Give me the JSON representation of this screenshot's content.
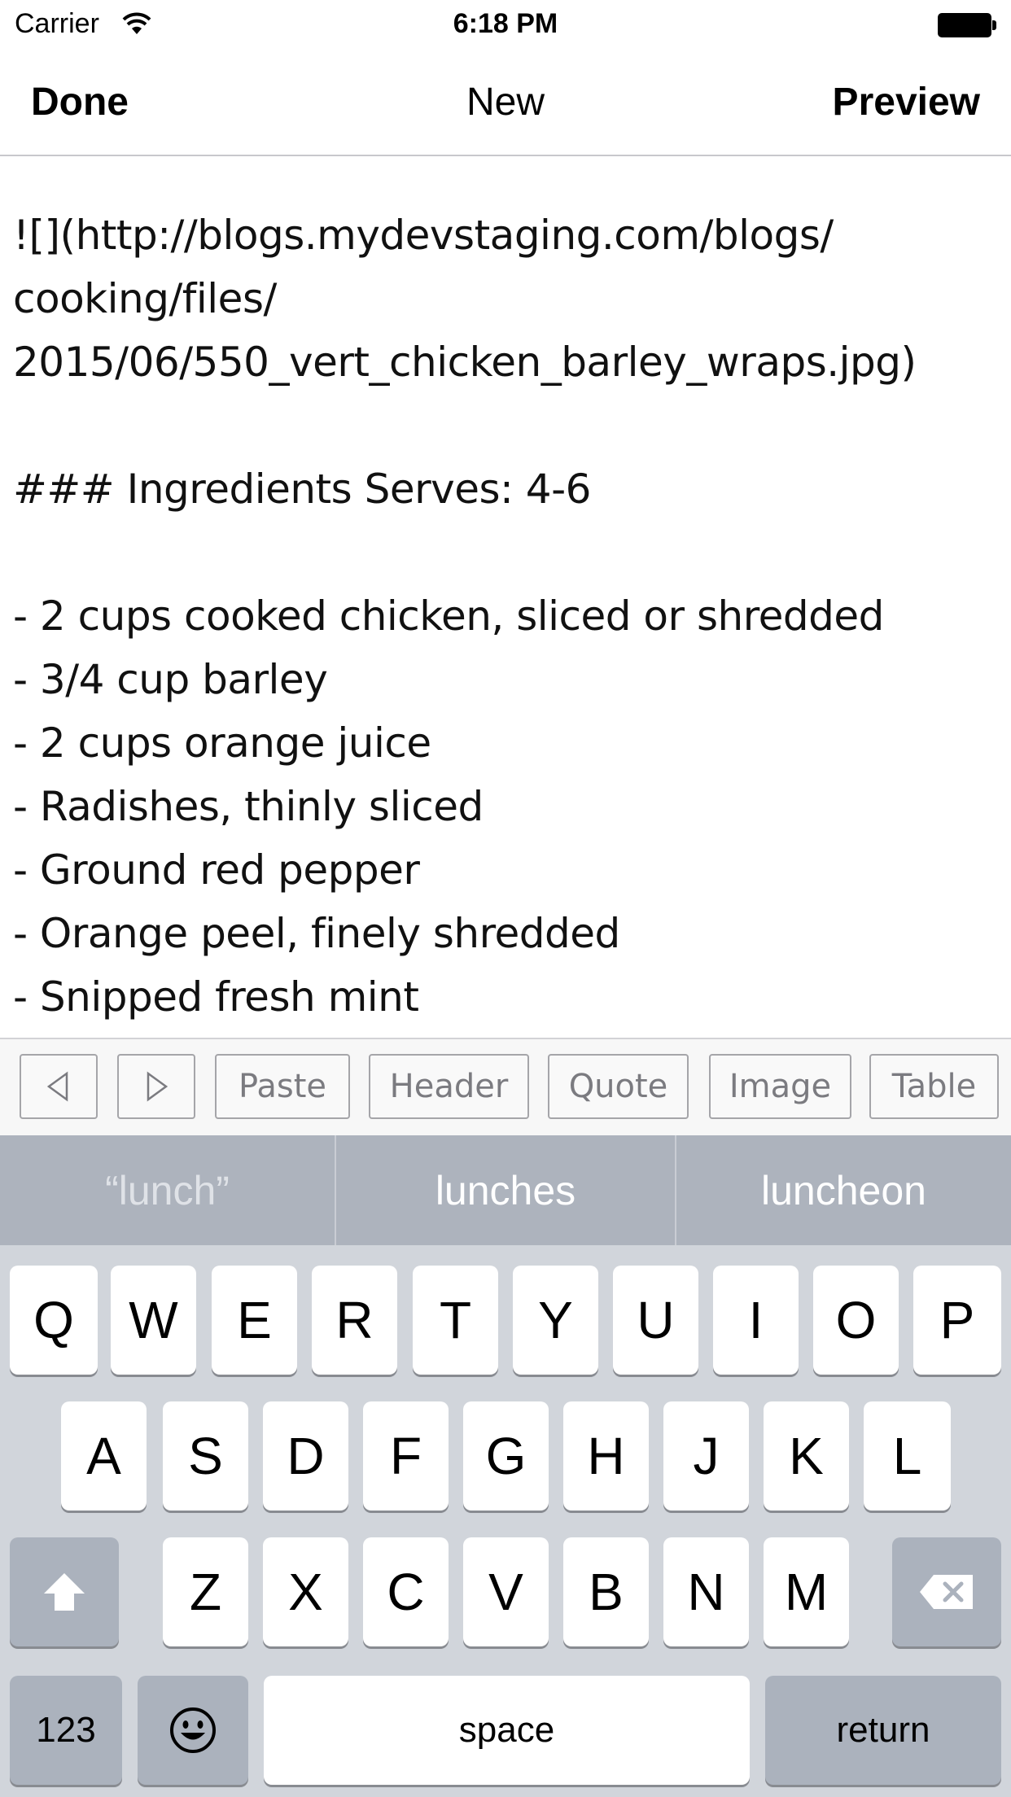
{
  "status_bar": {
    "carrier": "Carrier",
    "time": "6:18 PM"
  },
  "nav": {
    "left_button": "Done",
    "title": "New",
    "right_button": "Preview"
  },
  "editor": {
    "lines": [
      "![](http://blogs.mydevstaging.com/blogs/",
      "cooking/files/",
      "2015/06/550_vert_chicken_barley_wraps.jpg)",
      "",
      "### Ingredients Serves: 4-6",
      "",
      "- 2 cups cooked chicken, sliced or shredded",
      "- 3/4 cup barley",
      "- 2 cups orange juice",
      "- Radishes, thinly sliced",
      "- Ground red pepper",
      "- Orange peel, finely shredded",
      "- Snipped fresh mint"
    ]
  },
  "toolbar": {
    "left_arrow_icon": "triangle-left-icon",
    "right_arrow_icon": "triangle-right-icon",
    "paste": "Paste",
    "header": "Header",
    "quote": "Quote",
    "image": "Image",
    "table": "Table"
  },
  "keyboard": {
    "suggestions": [
      "“lunch”",
      "lunches",
      "luncheon"
    ],
    "row1": [
      "Q",
      "W",
      "E",
      "R",
      "T",
      "Y",
      "U",
      "I",
      "O",
      "P"
    ],
    "row2": [
      "A",
      "S",
      "D",
      "F",
      "G",
      "H",
      "J",
      "K",
      "L"
    ],
    "row3": [
      "Z",
      "X",
      "C",
      "V",
      "B",
      "N",
      "M"
    ],
    "numbers_key": "123",
    "space_key": "space",
    "return_key": "return",
    "shift_icon": "shift-icon",
    "delete_icon": "backspace-icon",
    "emoji_icon": "emoji-icon"
  },
  "colors": {
    "keyboard_bg": "#d1d5db",
    "suggestion_bar": "#adb3bd",
    "dark_key": "#abb2bd",
    "toolbar_text": "#7b7b80"
  }
}
